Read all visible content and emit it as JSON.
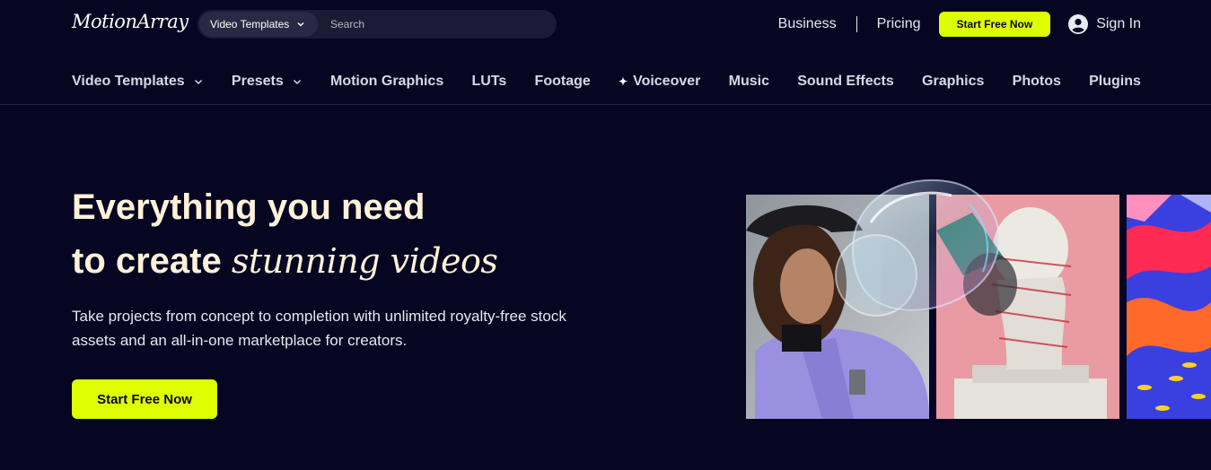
{
  "header": {
    "logo": "MotionArray",
    "search": {
      "category": "Video Templates",
      "placeholder": "Search"
    },
    "links": {
      "business": "Business",
      "pricing": "Pricing"
    },
    "start_button": "Start Free Now",
    "sign_in": "Sign In"
  },
  "nav": {
    "items": [
      "Video Templates",
      "Presets",
      "Motion Graphics",
      "LUTs",
      "Footage",
      "Voiceover",
      "Music",
      "Sound Effects",
      "Graphics",
      "Photos",
      "Plugins"
    ]
  },
  "hero": {
    "title_line1": "Everything you need",
    "title_line2_prefix": "to create",
    "title_line2_accent": "stunning videos",
    "subtitle": "Take projects from concept to completion with unlimited royalty-free stock assets and an all-in-one marketplace for creators.",
    "cta": "Start Free Now"
  },
  "colors": {
    "background": "#070622",
    "accent": "#ddff00",
    "headline": "#fdf2d8"
  },
  "icons": {
    "dropdown": "chevron-down-icon",
    "voiceover": "sparkle-icon",
    "account": "user-circle-icon"
  }
}
